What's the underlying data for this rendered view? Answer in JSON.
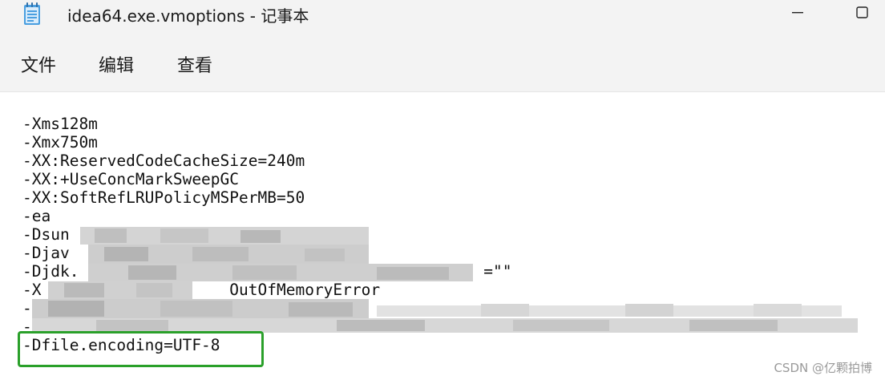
{
  "window": {
    "title": "idea64.exe.vmoptions - 记事本",
    "icon": "notepad-icon",
    "controls": {
      "minimize_icon": "minimize-icon",
      "maximize_icon": "maximize-icon"
    }
  },
  "menubar": {
    "items": [
      {
        "label": "文件"
      },
      {
        "label": "编辑"
      },
      {
        "label": "查看"
      }
    ]
  },
  "editor": {
    "lines": [
      "-Xms128m",
      "-Xmx750m",
      "-XX:ReservedCodeCacheSize=240m",
      "-XX:+UseConcMarkSweepGC",
      "-XX:SoftRefLRUPolicyMSPerMB=50",
      "-ea",
      "-Dsun                    false",
      "-Djav",
      "-Djdk.                                           =\"\"",
      "-X                    OutOfMemoryError",
      "-",
      "-",
      "-Dfile.encoding=UTF-8"
    ]
  },
  "highlight": {
    "color": "#2aa02a"
  },
  "watermark": {
    "text": "CSDN @亿颗拍博"
  }
}
